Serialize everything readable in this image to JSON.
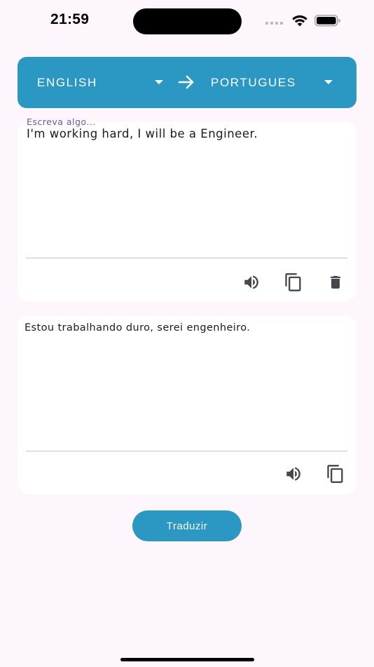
{
  "status_bar": {
    "time": "21:59",
    "icons": [
      "signal-dots-icon",
      "wifi-icon",
      "battery-icon"
    ]
  },
  "language_bar": {
    "from_language": "ENGLISH",
    "to_language": "PORTUGUES",
    "swap_icon": "arrow-right-icon",
    "dropdown_icon": "caret-down-icon"
  },
  "input_card": {
    "label": "Escreva algo...",
    "text": "I'm working hard, I will be a Engineer.",
    "actions": [
      "speaker-icon",
      "copy-icon",
      "trash-icon"
    ]
  },
  "output_card": {
    "text": "Estou trabalhando duro, serei engenheiro.",
    "actions": [
      "speaker-icon",
      "copy-icon"
    ]
  },
  "translate_button": {
    "label": "Traduzir"
  },
  "colors": {
    "primary": "#2b97c3",
    "background": "#fdf6fd",
    "card": "#ffffff",
    "label": "#6a5aa5",
    "icon": "#46464f"
  }
}
